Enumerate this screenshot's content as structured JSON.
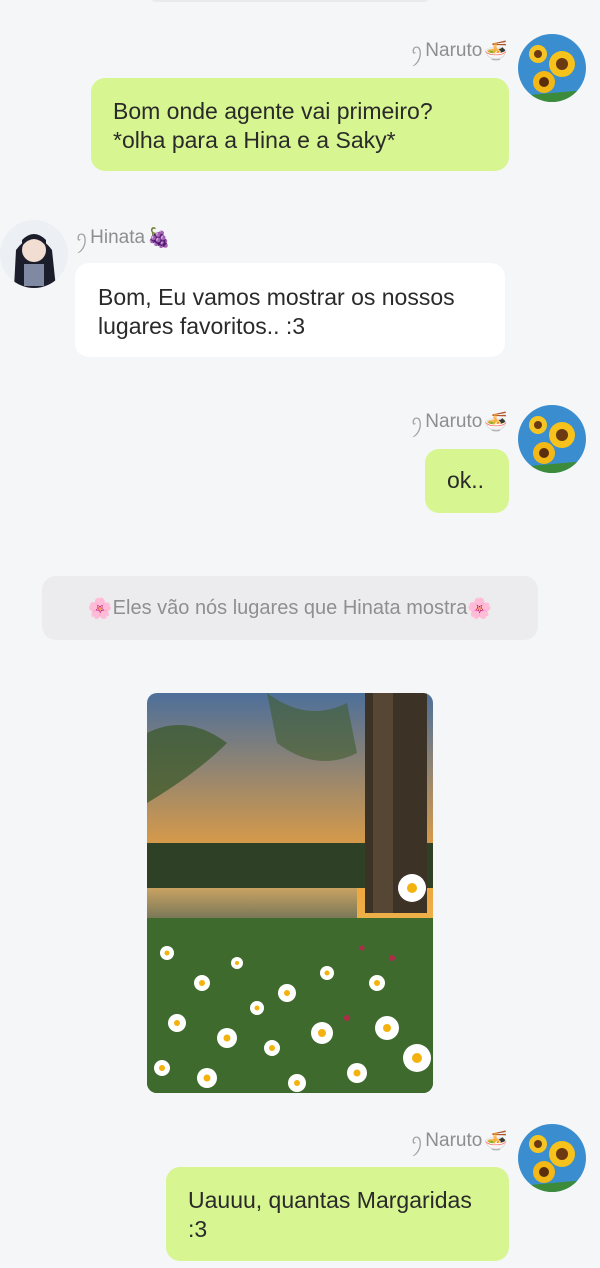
{
  "messages": [
    {
      "sender": "Naruto",
      "sender_prefix": "ꪆ",
      "sender_emoji": "🍜",
      "text": "Bom onde agente vai primeiro?\n*olha para a Hina e a Saky*"
    },
    {
      "sender": "Hinata",
      "sender_prefix": "ꪆ",
      "sender_emoji": "🍇",
      "text": "Bom, Eu vamos mostrar os nossos\nlugares favoritos.. :3"
    },
    {
      "sender": "Naruto",
      "sender_prefix": "ꪆ",
      "sender_emoji": "🍜",
      "text": "ok.."
    },
    {
      "sender": "Naruto",
      "sender_prefix": "ꪆ",
      "sender_emoji": "🍜",
      "text": "Uauuu, quantas Margaridas\n :3"
    }
  ],
  "system_message": {
    "emoji_left": "🌸",
    "text": "Eles vão nós lugares que Hinata mostra",
    "emoji_right": "🌸"
  },
  "colors": {
    "background": "#f5f6f8",
    "bubble_self": "#d7f590",
    "bubble_other": "#ffffff",
    "system_bubble": "#ececee",
    "name_text": "#8e8e8e"
  },
  "icons": {
    "naruto_avatar": "sunflower-avatar",
    "hinata_avatar": "anime-girl-avatar",
    "shared_image": "daisy-field-sunset-photo"
  }
}
